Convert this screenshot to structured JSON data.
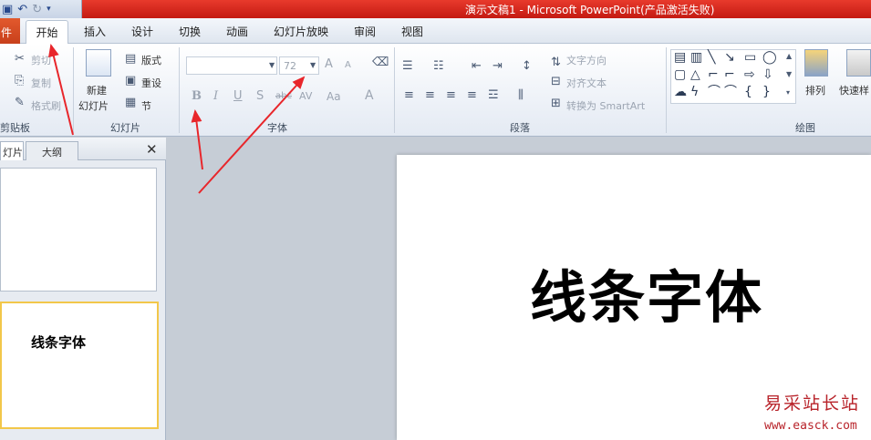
{
  "title_bar": {
    "title": "演示文稿1 - Microsoft PowerPoint(产品激活失败)"
  },
  "quick_access": {
    "icons": [
      "save-icon",
      "undo-icon",
      "redo-icon",
      "customize-icon"
    ]
  },
  "tabs": {
    "file": "件",
    "home": "开始",
    "items": [
      "插入",
      "设计",
      "切换",
      "动画",
      "幻灯片放映",
      "审阅",
      "视图"
    ]
  },
  "ribbon": {
    "clipboard": {
      "label": "剪贴板",
      "cut": "剪切",
      "copy": "复制",
      "format_painter": "格式刷"
    },
    "slides": {
      "label": "幻灯片",
      "new_slide_1": "新建",
      "new_slide_2": "幻灯片",
      "layout": "版式",
      "reset": "重设",
      "section": "节"
    },
    "font": {
      "label": "字体",
      "font_name": "",
      "font_size": "72",
      "bold": "B",
      "italic": "I",
      "underline": "U",
      "shadow": "S",
      "strike": "abc",
      "spacing": "AV",
      "case": "Aa",
      "color": "A",
      "grow": "A",
      "shrink": "A"
    },
    "paragraph": {
      "label": "段落",
      "text_direction": "文字方向",
      "align_text": "对齐文本",
      "smartart": "转换为 SmartArt"
    },
    "drawing": {
      "label": "绘图",
      "arrange": "排列",
      "quick_styles": "快速样"
    }
  },
  "left_pane": {
    "tab_slides": "灯片",
    "tab_outline": "大纲",
    "close": "✕",
    "thumb2_text": "线条字体"
  },
  "slide": {
    "title": "线条字体"
  },
  "watermark": {
    "name": "易采站长站",
    "url": "www.easck.com"
  },
  "colors": {
    "title_bar": "#d9271c",
    "file_tab": "#d84a22",
    "annotation_arrow": "#e8262b",
    "selected_thumb": "#f2c74a"
  }
}
